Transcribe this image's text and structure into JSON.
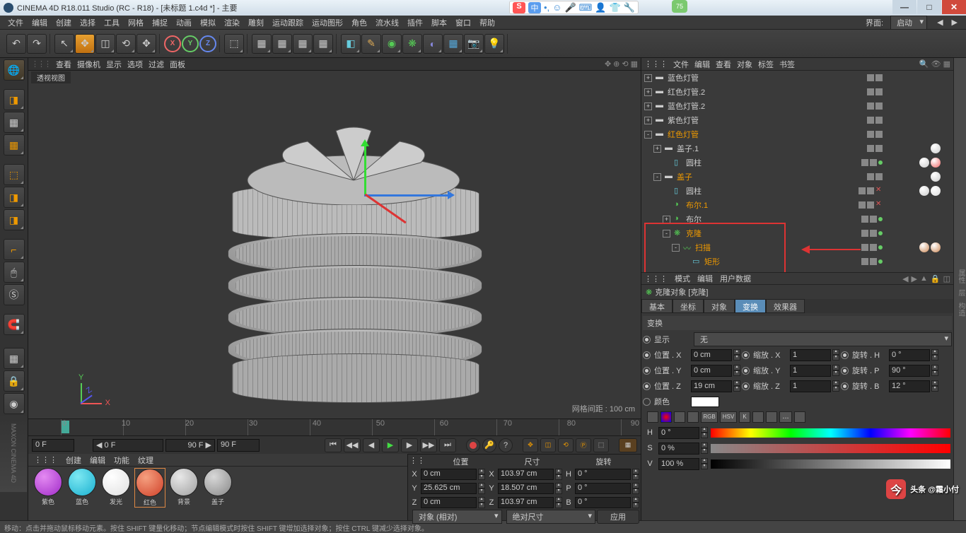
{
  "title": "CINEMA 4D R18.011 Studio (RC - R18) - [未标题 1.c4d *] - 主要",
  "badge": "75",
  "menu": [
    "文件",
    "编辑",
    "创建",
    "选择",
    "工具",
    "网格",
    "捕捉",
    "动画",
    "模拟",
    "渲染",
    "雕刻",
    "运动跟踪",
    "运动图形",
    "角色",
    "流水线",
    "插件",
    "脚本",
    "窗口",
    "帮助"
  ],
  "layout_label": "界面:",
  "layout_value": "启动",
  "vp_menu": [
    "查看",
    "摄像机",
    "显示",
    "选项",
    "过滤",
    "面板"
  ],
  "vp_tab": "透视视图",
  "vp_grid": "网格间距 : 100 cm",
  "timeline": {
    "start": "0 F",
    "cur": "0 F",
    "end": "90 F",
    "end2": "90 F",
    "ticks": [
      "0",
      "10",
      "20",
      "30",
      "40",
      "50",
      "60",
      "70",
      "80",
      "90"
    ]
  },
  "mat_tabs": [
    "创建",
    "编辑",
    "功能",
    "纹理"
  ],
  "materials": [
    {
      "name": "紫色",
      "c1": "#e48af2",
      "c2": "#a02bc8"
    },
    {
      "name": "蓝色",
      "c1": "#7de8f2",
      "c2": "#1ab0d0"
    },
    {
      "name": "发光",
      "c1": "#ffffff",
      "c2": "#e0e0e0"
    },
    {
      "name": "红色",
      "c1": "#f5a080",
      "c2": "#d04028",
      "sel": true
    },
    {
      "name": "背景",
      "c1": "#e8e8e8",
      "c2": "#a0a0a0"
    },
    {
      "name": "盖子",
      "c1": "#d8d8d8",
      "c2": "#888888"
    }
  ],
  "coord": {
    "hdrs": [
      "位置",
      "尺寸",
      "旋转"
    ],
    "rows": [
      {
        "a": "X",
        "p": "0 cm",
        "s": "103.97 cm",
        "r": "H",
        "rv": "0 °"
      },
      {
        "a": "Y",
        "p": "25.625 cm",
        "s": "18.507 cm",
        "r": "P",
        "rv": "0 °"
      },
      {
        "a": "Z",
        "p": "0 cm",
        "s": "103.97 cm",
        "r": "B",
        "rv": "0 °"
      }
    ],
    "mode1": "对象 (相对)",
    "mode2": "绝对尺寸",
    "apply": "应用"
  },
  "om_tabs": [
    "文件",
    "编辑",
    "查看",
    "对象",
    "标签",
    "书签"
  ],
  "om_tree": [
    {
      "d": 0,
      "exp": "+",
      "ico": "layer",
      "name": "蓝色灯管",
      "flags": "gg"
    },
    {
      "d": 0,
      "exp": "+",
      "ico": "layer",
      "name": "红色灯管.2",
      "flags": "gg"
    },
    {
      "d": 0,
      "exp": "+",
      "ico": "layer",
      "name": "蓝色灯管.2",
      "flags": "gg"
    },
    {
      "d": 0,
      "exp": "+",
      "ico": "layer",
      "name": "紫色灯管",
      "flags": "gg"
    },
    {
      "d": 0,
      "exp": "-",
      "ico": "layer",
      "name": "红色灯管",
      "sel": true,
      "flags": "gg"
    },
    {
      "d": 1,
      "exp": "+",
      "ico": "layer",
      "name": "盖子.1",
      "flags": "gg",
      "tags": [
        "#ccc"
      ]
    },
    {
      "d": 2,
      "exp": "",
      "ico": "cyl",
      "name": "圆柱",
      "flags": "ggv",
      "tags": [
        "#ccc",
        "#e66"
      ]
    },
    {
      "d": 1,
      "exp": "-",
      "ico": "layer",
      "name": "盖子",
      "sel": true,
      "flags": "gg",
      "tags": [
        "#ccc"
      ]
    },
    {
      "d": 2,
      "exp": "",
      "ico": "cyl",
      "name": "圆柱",
      "flags": "ggx",
      "tags": [
        "#ccc",
        "#ddd"
      ]
    },
    {
      "d": 2,
      "exp": "",
      "ico": "bool",
      "name": "布尔.1",
      "sel": true,
      "flags": "ggx"
    },
    {
      "d": 2,
      "exp": "+",
      "ico": "bool",
      "name": "布尔",
      "flags": "ggv"
    },
    {
      "d": 2,
      "exp": "-",
      "ico": "clone",
      "name": "克隆",
      "sel": true,
      "flags": "ggv"
    },
    {
      "d": 3,
      "exp": "-",
      "ico": "sweep",
      "name": "扫描",
      "sel": true,
      "flags": "ggv",
      "tags": [
        "#c85",
        "#c85"
      ]
    },
    {
      "d": 4,
      "exp": "",
      "ico": "rect",
      "name": "矩形",
      "sel": true,
      "flags": "ggv"
    },
    {
      "d": 4,
      "exp": "",
      "ico": "arc",
      "name": "圆弧",
      "sel": true,
      "flags": "ggv"
    }
  ],
  "am_tabs2": [
    "模式",
    "编辑",
    "用户数据"
  ],
  "am_title": "克隆对象 [克隆]",
  "am_tabs": [
    "基本",
    "坐标",
    "对象",
    "变换",
    "效果器"
  ],
  "am_active": "变换",
  "am_section": "变换",
  "am_display": "显示",
  "am_display_v": "无",
  "am_fields": {
    "pos": [
      {
        "l": "位置 . X",
        "v": "0 cm"
      },
      {
        "l": "位置 . Y",
        "v": "0 cm"
      },
      {
        "l": "位置 . Z",
        "v": "19 cm"
      }
    ],
    "scale": [
      {
        "l": "缩放 . X",
        "v": "1"
      },
      {
        "l": "缩放 . Y",
        "v": "1"
      },
      {
        "l": "缩放 . Z",
        "v": "1"
      }
    ],
    "rot": [
      {
        "l": "旋转 . H",
        "v": "0 °"
      },
      {
        "l": "旋转 . P",
        "v": "90 °"
      },
      {
        "l": "旋转 . B",
        "v": "12 °"
      }
    ]
  },
  "am_color": "颜色",
  "hsv": [
    {
      "l": "H",
      "v": "0 °"
    },
    {
      "l": "S",
      "v": "0 %"
    },
    {
      "l": "V",
      "v": "100 %"
    }
  ],
  "sw_labels": [
    "RGB",
    "HSV",
    "K",
    "..."
  ],
  "status": "移动：点击并拖动鼠标移动元素。按住 SHIFT 键量化移动；节点编辑模式时按住 SHIFT 键增加选择对象；按住 CTRL 键减少选择对象。",
  "watermark": "头条 @霜小付",
  "brand": "MAXON CINEMA 4D"
}
